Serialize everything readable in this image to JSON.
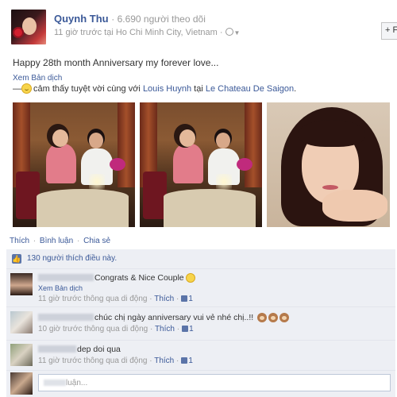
{
  "post": {
    "author": "Quynh Thu",
    "followers": "· 6.690 người theo dõi",
    "meta": "11 giờ trước tại Ho Chi Minh City, Vietnam ·",
    "status_text": "Happy 28th month Anniversary my forever love...",
    "translate_label": "Xem Bản dịch",
    "feeling_prefix": "—",
    "feeling_text": "cảm thấy tuyệt vời cùng với",
    "tagged_person": "Louis Huynh",
    "at_word": "tại",
    "place": "Le Chateau De Saigon",
    "end_punct": "."
  },
  "top_button": {
    "label": "+ F"
  },
  "actions": {
    "like": "Thích",
    "comment": "Bình luận",
    "share": "Chia sẻ",
    "sep": "·"
  },
  "likes": {
    "text": "130 người thích điều này."
  },
  "comments": [
    {
      "text": "Congrats & Nice Couple",
      "translate": "Xem Bản dịch",
      "time": "11 giờ trước thông qua di động ·",
      "like": "Thích",
      "dot": "·",
      "count": "1"
    },
    {
      "text": "chúc chị ngày anniversary vui vẻ nhé chị..!!",
      "time": "10 giờ trước thông qua di động ·",
      "like": "Thích",
      "dot": "·",
      "count": "1"
    },
    {
      "text": "dep doi qua",
      "time": "11 giờ trước thông qua di động ·",
      "like": "Thích",
      "dot": "·",
      "count": "1"
    }
  ],
  "compose": {
    "placeholder_tail": "luận..."
  }
}
